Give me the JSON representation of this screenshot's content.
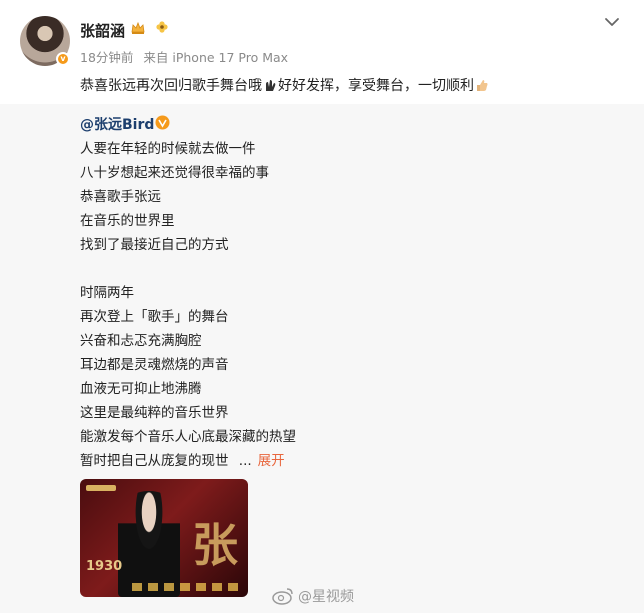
{
  "post": {
    "author": "张韶涵",
    "time": "18分钟前",
    "source": "来自 iPhone 17 Pro Max",
    "text_part1": "恭喜张远再次回归歌手舞台哦",
    "text_part2": "好好发挥，享受舞台，一切顺利",
    "icons": [
      "crown-icon",
      "flower-icon",
      "chevron-down-icon",
      "hands-emoji",
      "thumbs-up-emoji"
    ]
  },
  "repost": {
    "author": "@张远Bird",
    "lines": [
      "人要在年轻的时候就去做一件",
      "八十岁想起来还觉得很幸福的事",
      "恭喜歌手张远",
      "在音乐的世界里",
      "找到了最接近自己的方式",
      "",
      "时隔两年",
      "再次登上「歌手」的舞台",
      "兴奋和忐忑充满胸腔",
      "耳边都是灵魂燃烧的声音",
      "血液无可抑止地沸腾",
      "这里是最纯粹的音乐世界",
      "能激发每个音乐人心底最深藏的热望",
      "暂时把自己从庞复的现世"
    ],
    "ellipsis": "...",
    "expand_label": "展开",
    "thumbnail": {
      "big_char": "张",
      "date": "1930"
    }
  },
  "watermark": "@星视频",
  "colors": {
    "link": "#1d3f6e",
    "expand": "#e8663d",
    "repost_bg": "#f7f7f7",
    "badge": "#f59a1b"
  }
}
